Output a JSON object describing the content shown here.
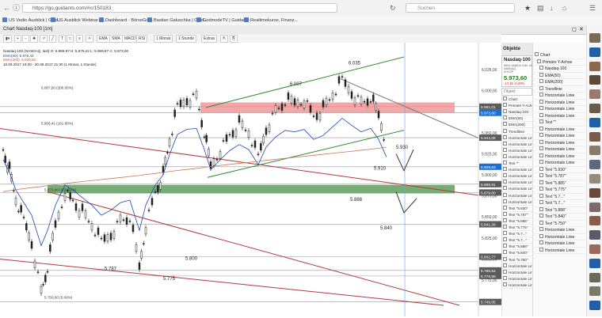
{
  "browser": {
    "url": "https://go.guidants.com/#c/150183",
    "search_placeholder": "Suchen",
    "bookmarks": [
      {
        "label": "US Vedio Ausblick | Guid..."
      },
      {
        "label": "US Ausblick Webinar | ..."
      },
      {
        "label": "Dashboard - BörseGo ..."
      },
      {
        "label": "Bastian Galuschka | Guid..."
      },
      {
        "label": "GodmodeTV | Guidants"
      },
      {
        "label": "Realtimekurse, Finanz..."
      }
    ]
  },
  "window": {
    "title": "Chart Nasdaq-100 [1m]"
  },
  "toolbar": {
    "items": [
      "EMA",
      "SMA",
      "MACD",
      "RSI",
      "1 Monat",
      "1 Stunde",
      "Extras"
    ]
  },
  "chart_info": {
    "line1": "Nasdaq-100 (NASDAQ, last)  O: 5.959,87  H: 5.976,22  L: 5.959,87  C: 5.973,60",
    "line2": "EMA(50): 5.976,43",
    "line3": "EMA(200): 5.929,50",
    "line4": "16.08.2017 16:30 - 20.09.2017 21:30  (1 Monat, 1 Stunde)"
  },
  "chart_data": {
    "type": "line",
    "ylim": [
      5745,
      6040
    ],
    "y_ticks": [
      "6.025,00",
      "6.000,00",
      "5.975,00",
      "5.950,00",
      "5.925,00",
      "5.900,00",
      "5.875,00",
      "5.850,00",
      "5.825,00",
      "5.800,00",
      "5.775,00",
      "5.750,00"
    ],
    "price_badges": [
      {
        "label": "5.981,01",
        "value": 5981.01,
        "color": "#5b5b5b"
      },
      {
        "label": "5.973,60",
        "value": 5973.6,
        "color": "#1a6fd6"
      },
      {
        "label": "5.944,08",
        "value": 5944.08,
        "color": "#5b5b5b"
      },
      {
        "label": "5.909,63",
        "value": 5909.63,
        "color": "#1a6fd6"
      },
      {
        "label": "5.888,91",
        "value": 5888.91,
        "color": "#5b5b5b"
      },
      {
        "label": "5.879,00",
        "value": 5879.0,
        "color": "#5b5b5b"
      },
      {
        "label": "5.841,28",
        "value": 5841.28,
        "color": "#5b5b5b"
      },
      {
        "label": "5.802,77",
        "value": 5802.77,
        "color": "#5b5b5b"
      },
      {
        "label": "5.786,54",
        "value": 5786.54,
        "color": "#5b5b5b"
      },
      {
        "label": "5.779,88",
        "value": 5779.88,
        "color": "#5b5b5b"
      },
      {
        "label": "5.749,05",
        "value": 5749.05,
        "color": "#5b5b5b"
      }
    ],
    "fib_labels": [
      {
        "text": "6.087,50 (200.00%)",
        "value": 6000
      },
      {
        "text": "5.958,41 (161.80%)",
        "value": 5958
      },
      {
        "text": "5.879,00 (100.00%)",
        "value": 5879
      },
      {
        "text": "5.750,50 (0.00%)",
        "value": 5751
      }
    ],
    "annotations": [
      {
        "text": "6.035",
        "value": 6031
      },
      {
        "text": "6.007",
        "value": 6006
      },
      {
        "text": "5.930",
        "value": 5931
      },
      {
        "text": "5.910",
        "value": 5906
      },
      {
        "text": "5.888",
        "value": 5869
      },
      {
        "text": "5.840",
        "value": 5835
      },
      {
        "text": "5.800",
        "value": 5799
      },
      {
        "text": "5.787",
        "value": 5787
      },
      {
        "text": "5.775",
        "value": 5775
      }
    ]
  },
  "watchlist": {
    "name": "Nasdaq-100",
    "meta1": "WKN: A0AE1X  ISIN: US6311011026",
    "meta2": "NASDAQ",
    "meta3": "Vt   EOP",
    "price": "5.973,60",
    "change": "-17,46  -0,29%",
    "colors": {
      "price": "#1e7b1e",
      "change": "#c62828"
    }
  },
  "objects": {
    "title": "Objekte",
    "filter_placeholder": "Objekt",
    "items": [
      "Chart",
      "Primäre Y-Achse",
      "Nasdaq-100",
      "EMA(50)",
      "EMA(200)",
      "Trendlinie",
      "Horizontale Linie",
      "Horizontale Linie",
      "Horizontale Linie",
      "Horizontale Linie",
      "Text \"\"",
      "Horizontale Linie",
      "Horizontale Linie",
      "Horizontale Linie",
      "Horizontale Linie",
      "Horizontale Linie",
      "Horizontale Linie",
      "Text \"5.930\"",
      "Text \"5.787\"",
      "Text \"5.885\"",
      "Text \"5.775\"",
      "Text \"5.7...\"",
      "Text \"5.7...\"",
      "Text \"5.888\"",
      "Text \"5.840\"",
      "Text \"5.750\"",
      "Horizontale Linie",
      "Horizontale Linie",
      "Horizontale Linie",
      "Horizontale Linie"
    ]
  },
  "rail_icons": [
    {
      "name": "avatar-1"
    },
    {
      "name": "dpa-afx-logo"
    },
    {
      "name": "avatar-2"
    },
    {
      "name": "avatar-3"
    },
    {
      "name": "avatar-4"
    },
    {
      "name": "avatar-5"
    },
    {
      "name": "dpa-afx-logo"
    },
    {
      "name": "avatar-6"
    },
    {
      "name": "avatar-7"
    },
    {
      "name": "avatar-8"
    },
    {
      "name": "avatar-9"
    },
    {
      "name": "avatar-10"
    },
    {
      "name": "avatar-11"
    },
    {
      "name": "avatar-12"
    },
    {
      "name": "avatar-13"
    },
    {
      "name": "avatar-14"
    },
    {
      "name": "dpa-afx-logo"
    },
    {
      "name": "avatar-15"
    },
    {
      "name": "avatar-16"
    },
    {
      "name": "dpa-afx-logo"
    }
  ]
}
